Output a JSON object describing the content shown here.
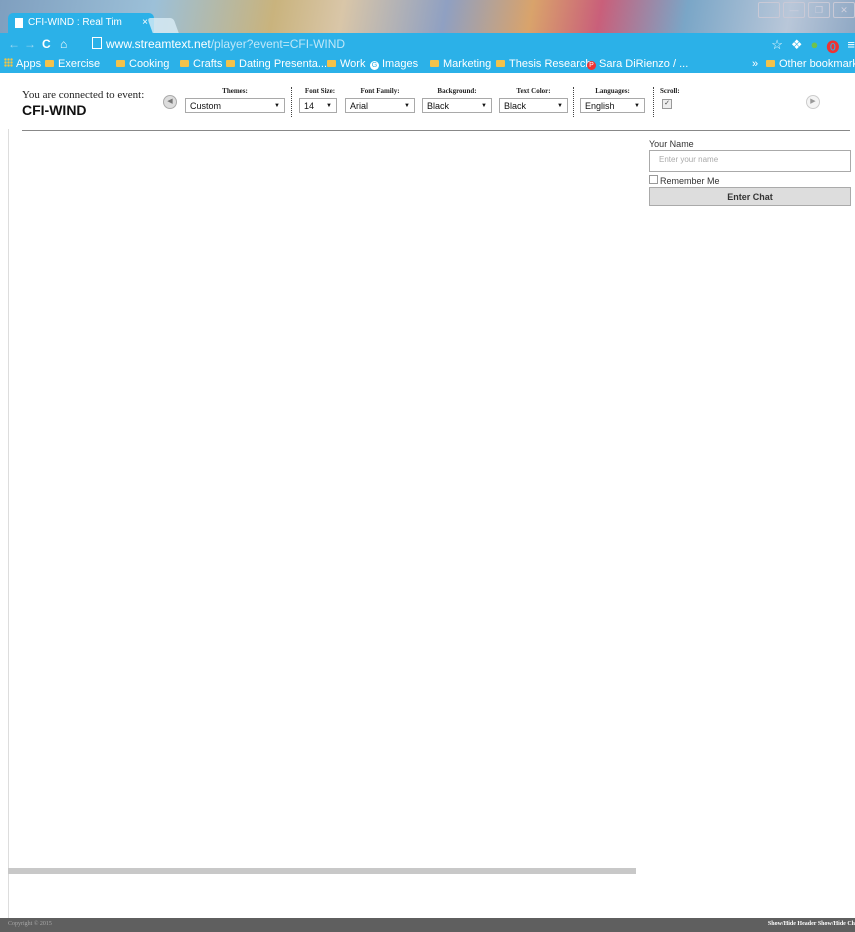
{
  "browser": {
    "tab_title": "CFI-WIND : Real Tim",
    "tab_close": "×",
    "window_buttons": [
      "⁠⁠⁠",
      "—",
      "❐",
      "✕"
    ],
    "nav": {
      "back": "←",
      "forward": "→",
      "reload": "C",
      "home": "⌂"
    },
    "url_host": "www.streamtext.net",
    "url_path": "/player?event=CFI-WIND",
    "extension_icons": [
      "☆",
      "❖",
      "●",
      "⓿",
      "≡"
    ]
  },
  "bookmarks": {
    "items": [
      {
        "label": "Apps",
        "icon": "apps-icon"
      },
      {
        "label": "Exercise",
        "icon": "folder-icon"
      },
      {
        "label": "Cooking",
        "icon": "folder-icon"
      },
      {
        "label": "Crafts",
        "icon": "folder-icon"
      },
      {
        "label": "Dating Presenta...",
        "icon": "folder-icon"
      },
      {
        "label": "Work",
        "icon": "folder-icon"
      },
      {
        "label": "Images",
        "icon": "google-icon"
      },
      {
        "label": "Marketing",
        "icon": "folder-icon"
      },
      {
        "label": "Thesis Research",
        "icon": "folder-icon"
      },
      {
        "label": "Sara DiRienzo / ...",
        "icon": "pinterest-icon"
      }
    ],
    "overflow": "»",
    "other": "Other bookmarks"
  },
  "player": {
    "connected_text": "You are connected to event:",
    "event_name": "CFI-WIND",
    "controls": {
      "themes": {
        "label": "Themes:",
        "value": "Custom"
      },
      "font_size": {
        "label": "Font Size:",
        "value": "14"
      },
      "font_family": {
        "label": "Font Family:",
        "value": "Arial"
      },
      "background": {
        "label": "Background:",
        "value": "Black"
      },
      "text_color": {
        "label": "Text Color:",
        "value": "Black"
      },
      "languages": {
        "label": "Languages:",
        "value": "English"
      },
      "scroll": {
        "label": "Scroll:",
        "checked": "✓"
      }
    },
    "prev_arrow": "◀",
    "next_arrow": "▶"
  },
  "chat": {
    "your_name_label": "Your Name",
    "name_placeholder": "Enter your name",
    "remember_me": "Remember Me",
    "enter_button": "Enter Chat"
  },
  "footer": {
    "copyright": "Copyright © 2015",
    "links": "Show/Hide Header  Show/Hide Ch"
  },
  "colors": {
    "chrome_accent": "#2bb1e8",
    "footer_bg": "#5f5f5f"
  }
}
